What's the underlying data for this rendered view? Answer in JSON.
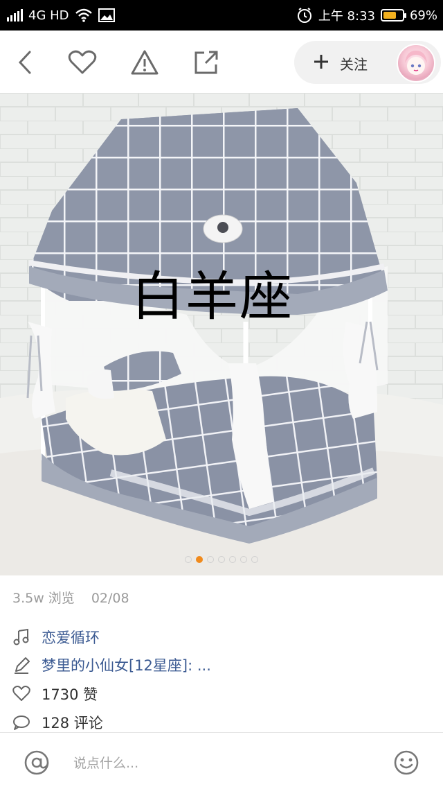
{
  "status_bar": {
    "network": "4G HD",
    "time": "上午 8:33",
    "battery": "69%",
    "battery_level": 0.69
  },
  "nav": {
    "follow_label": "关注"
  },
  "photo": {
    "caption": "白羊座",
    "dots_count": 7,
    "active_index": 1
  },
  "meta": {
    "views": "3.5w 浏览",
    "date": "02/08"
  },
  "rows": {
    "music": "恋爱循环",
    "author": "梦里的小仙女[12星座]: ...",
    "likes": "1730 赞",
    "comments": "128 评论"
  },
  "bottom": {
    "comment_placeholder": "说点什么..."
  }
}
